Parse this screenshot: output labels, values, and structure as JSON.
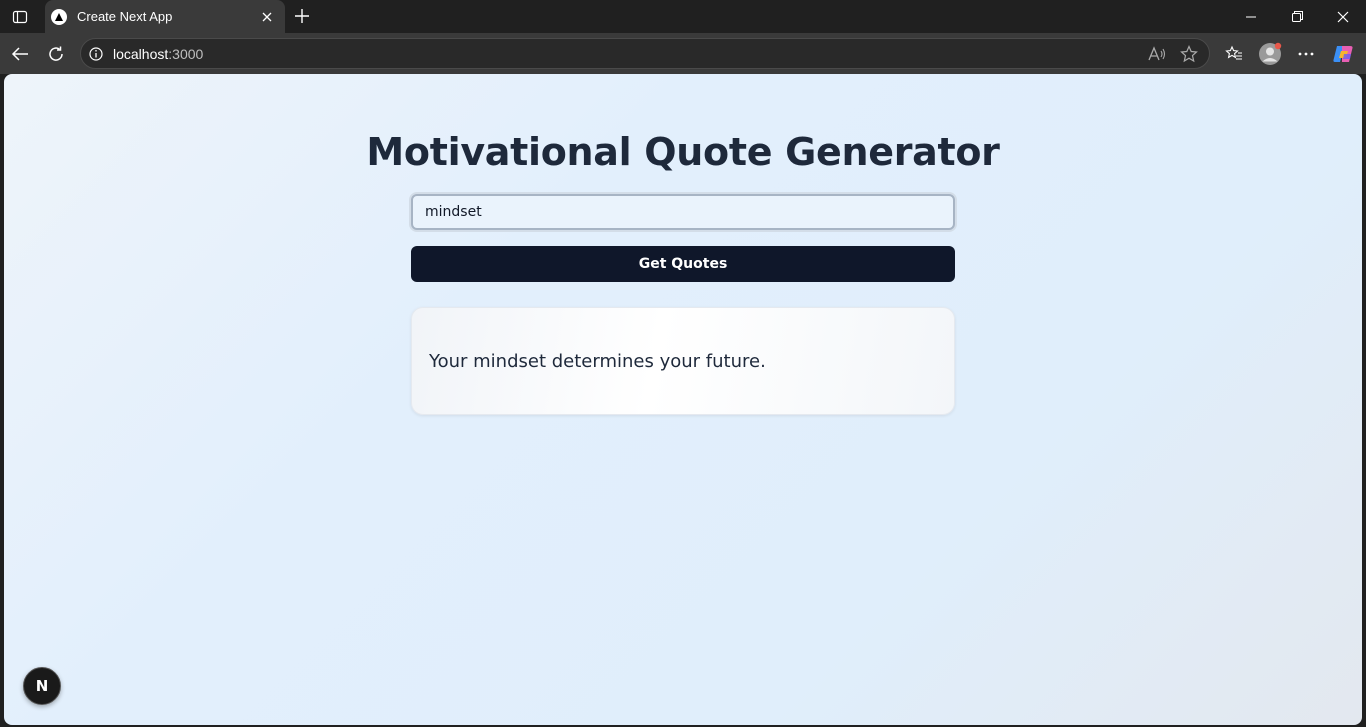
{
  "browser": {
    "tab_title": "Create Next App",
    "url_host": "localhost",
    "url_port": ":3000"
  },
  "page": {
    "heading": "Motivational Quote Generator",
    "search_value": "mindset",
    "button_label": "Get Quotes",
    "quote": "Your mindset determines your future.",
    "next_badge": "N"
  },
  "colors": {
    "button_bg": "#0f172a",
    "heading": "#1e293b"
  }
}
